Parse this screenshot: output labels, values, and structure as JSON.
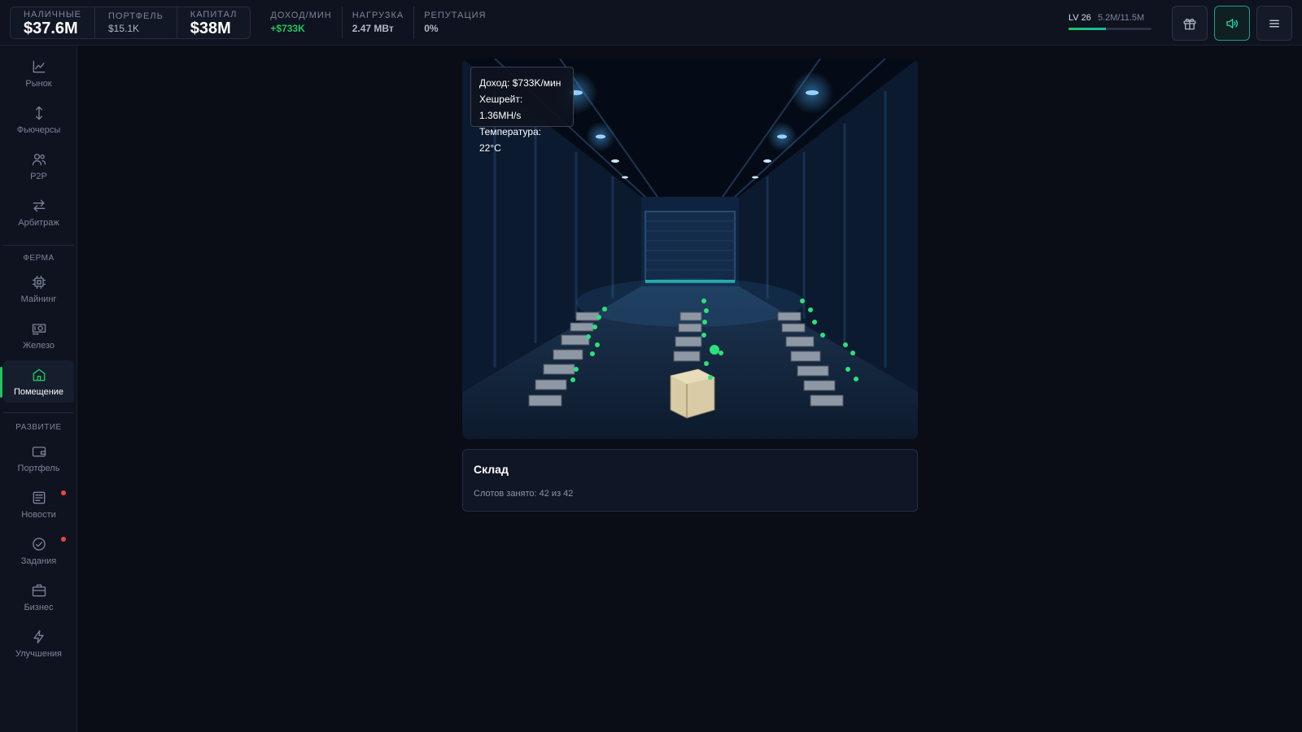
{
  "topbar": {
    "cash": {
      "label": "НАЛИЧНЫЕ",
      "value": "$37.6M"
    },
    "portfolio": {
      "label": "ПОРТФЕЛЬ",
      "value": "$15.1K"
    },
    "capital": {
      "label": "КАПИТАЛ",
      "value": "$38M"
    },
    "income": {
      "label": "ДОХОД/МИН",
      "value": "+$733K"
    },
    "load": {
      "label": "НАГРУЗКА",
      "value": "2.47 МВт"
    },
    "reputation": {
      "label": "РЕПУТАЦИЯ",
      "value": "0%"
    },
    "level": {
      "label": "LV 26",
      "xp": "5.2M/11.5M",
      "progress": 0.45
    },
    "buttons": {
      "gift": "gift-icon",
      "sound": "speaker-icon",
      "menu": "menu-icon"
    }
  },
  "sidebar": {
    "items": [
      {
        "label": "Рынок",
        "icon": "chart-line-icon"
      },
      {
        "label": "Фьючерсы",
        "icon": "arrows-vertical-icon"
      },
      {
        "label": "P2P",
        "icon": "users-icon"
      },
      {
        "label": "Арбитраж",
        "icon": "swap-icon"
      }
    ],
    "farm_section": "ФЕРМА",
    "farm_items": [
      {
        "label": "Майнинг",
        "icon": "cpu-icon"
      },
      {
        "label": "Железо",
        "icon": "gpu-icon"
      },
      {
        "label": "Помещение",
        "icon": "home-icon",
        "active": true
      }
    ],
    "dev_section": "РАЗВИТИЕ",
    "dev_items": [
      {
        "label": "Портфель",
        "icon": "wallet-icon"
      },
      {
        "label": "Новости",
        "icon": "news-icon",
        "badge": true
      },
      {
        "label": "Задания",
        "icon": "check-circle-icon",
        "badge": true
      },
      {
        "label": "Бизнес",
        "icon": "briefcase-icon"
      },
      {
        "label": "Улучшения",
        "icon": "bolt-icon"
      }
    ]
  },
  "tooltip": {
    "income": "Доход: $733K/мин",
    "hashrate": "Хешрейт: 1.36MH/s",
    "temperature": "Температура: 22°C"
  },
  "panel": {
    "title": "Склад",
    "slots": "Слотов занято: 42 из 42"
  },
  "colors": {
    "accent": "#22c55e",
    "badge": "#ef4444",
    "bg": "#0a0d16"
  }
}
